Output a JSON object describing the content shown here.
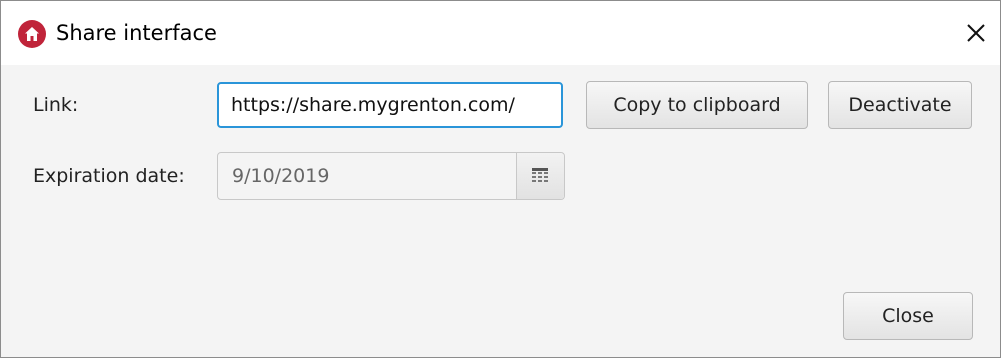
{
  "dialog": {
    "title": "Share interface",
    "icons": {
      "app": "home-icon",
      "close": "close-icon",
      "calendar": "calendar-icon"
    }
  },
  "link_row": {
    "label": "Link:",
    "value": "https://share.mygrenton.com/",
    "copy_label": "Copy to clipboard",
    "deactivate_label": "Deactivate"
  },
  "expiration_row": {
    "label": "Expiration date:",
    "value": "9/10/2019"
  },
  "footer": {
    "close_label": "Close"
  },
  "colors": {
    "accent": "#2a95d9",
    "brand": "#c0243a",
    "dialog_background": "#f4f4f4"
  }
}
